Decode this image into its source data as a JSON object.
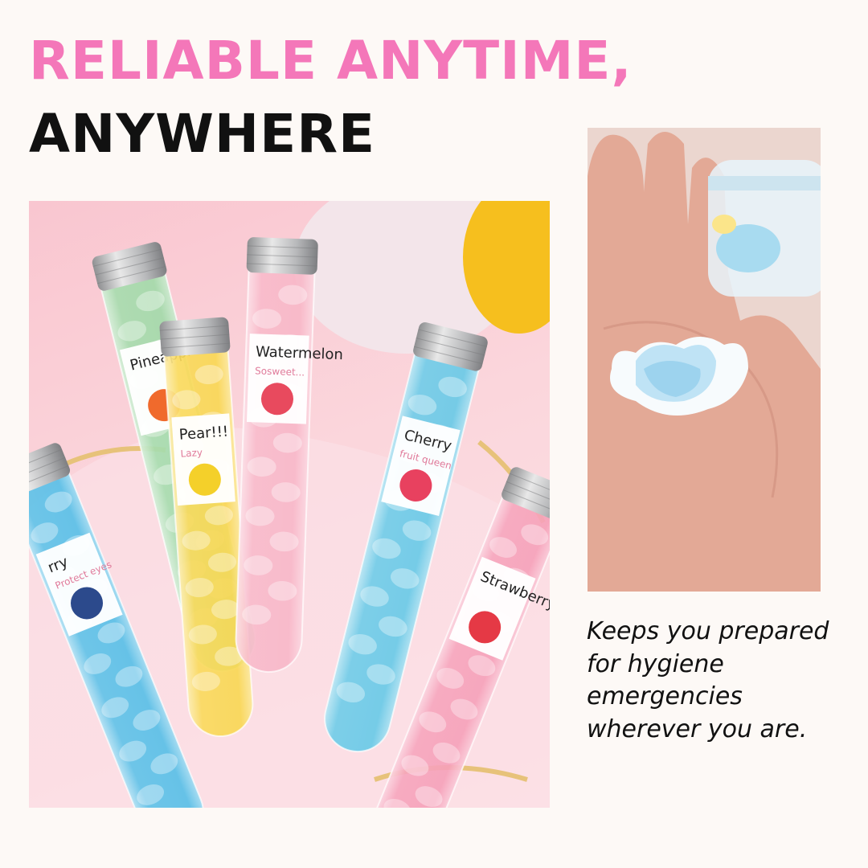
{
  "headline": {
    "line1": "RELIABLE ANYTIME,",
    "line2": "ANYWHERE"
  },
  "tubes": [
    {
      "label": "Pineapple",
      "fill": "#9bd8a4",
      "accent": "#f06a2c"
    },
    {
      "label": "Pear!!!",
      "sub": "Lazy",
      "fill": "#f8d548",
      "accent": "#f4d02a"
    },
    {
      "label": "Watermelon",
      "sub": "Sosweet...",
      "fill": "#f7b3c4",
      "accent": "#e84a5e"
    },
    {
      "label": "Cherry",
      "sub": "fruit queen",
      "fill": "#5ec7e6",
      "accent": "#e8415f"
    },
    {
      "label": "Strawberry",
      "fill": "#f59bb5",
      "accent": "#e53945"
    },
    {
      "label": "rry",
      "sub": "Protect eyes",
      "fill": "#4dbbe6",
      "accent": "#2c4a8c"
    }
  ],
  "blurb": "Keeps you prepared for hygiene emergencies wherever you are.",
  "colors": {
    "headline_accent": "#f477b9",
    "headline_dark": "#111111",
    "background": "#fdf9f6"
  }
}
